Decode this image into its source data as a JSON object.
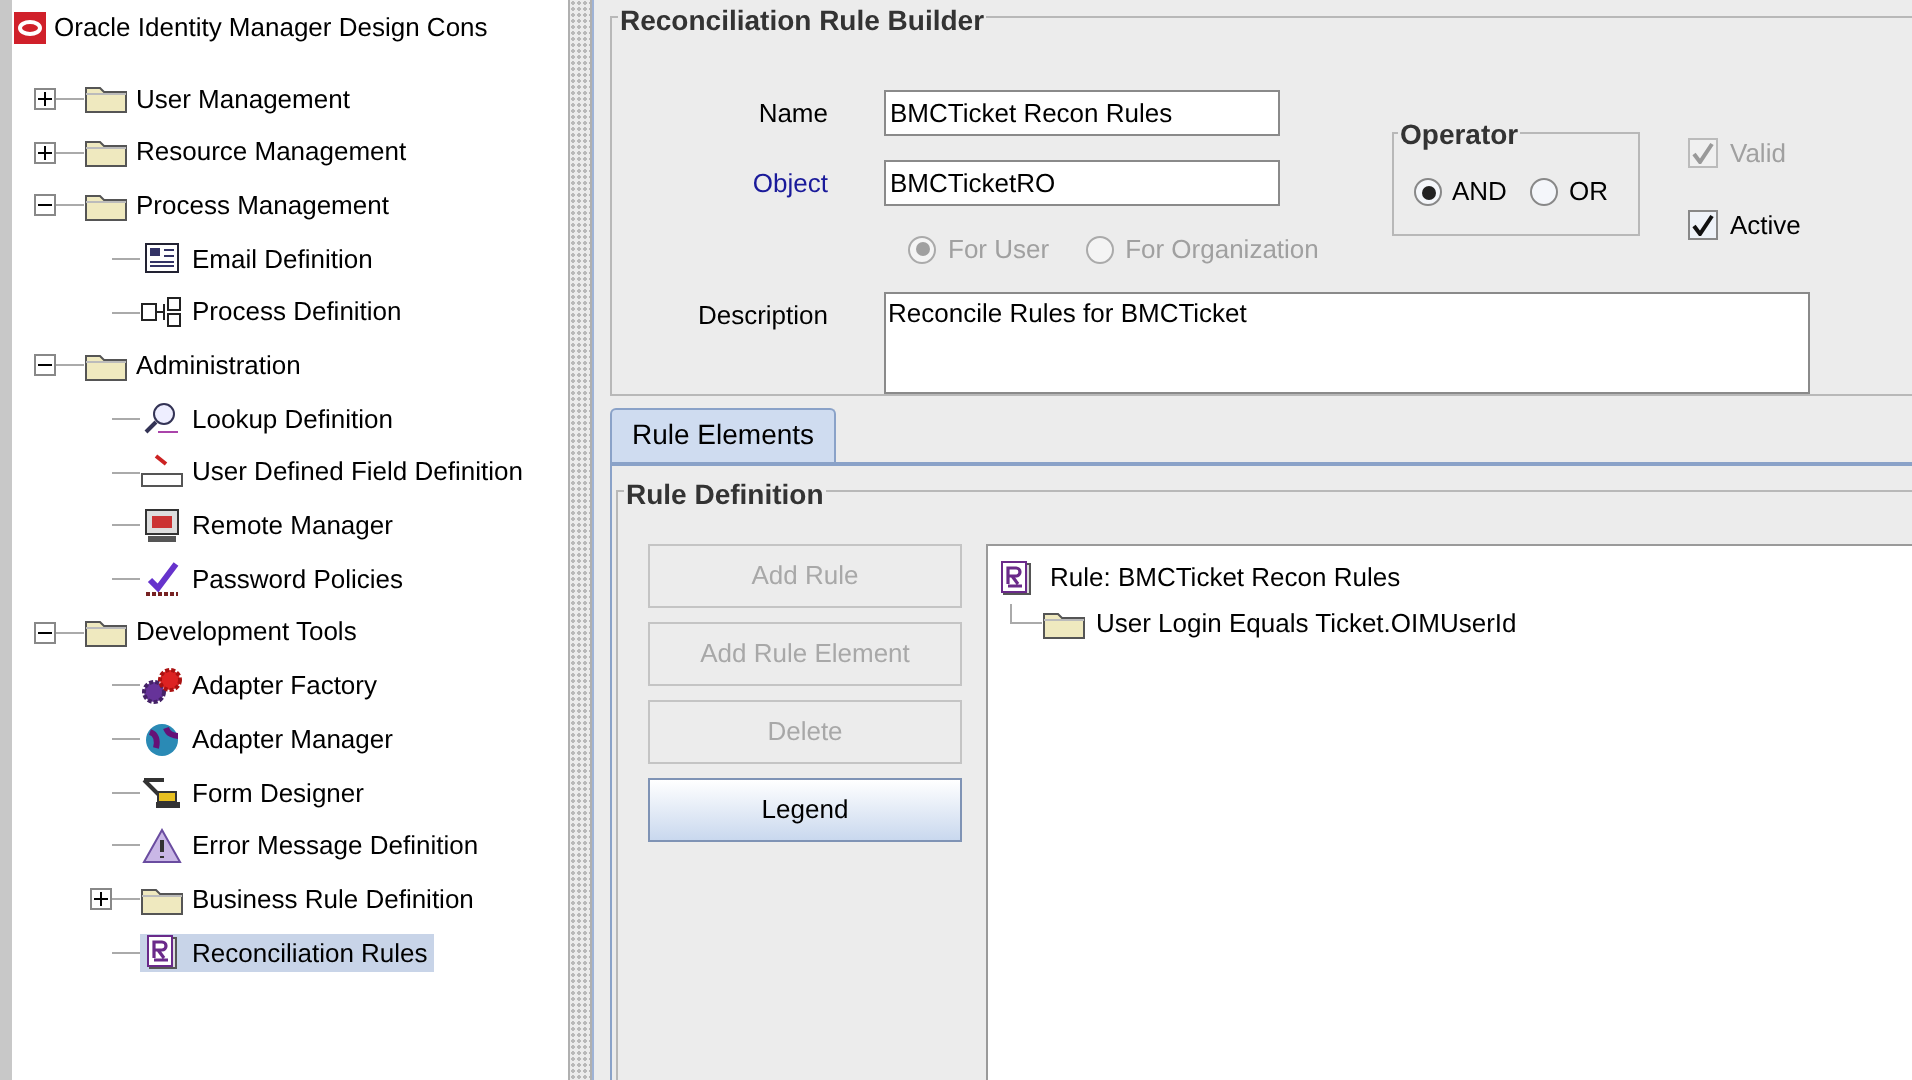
{
  "tree": {
    "title": "Oracle Identity Manager Design Cons",
    "items": [
      {
        "kind": "folder",
        "label": "User Management",
        "expanded": false,
        "selected": false
      },
      {
        "kind": "folder",
        "label": "Resource Management",
        "expanded": false,
        "selected": false
      },
      {
        "kind": "folder",
        "label": "Process Management",
        "expanded": true,
        "selected": false,
        "children": [
          {
            "kind": "email",
            "label": "Email Definition",
            "selected": false
          },
          {
            "kind": "process",
            "label": "Process Definition",
            "selected": false
          }
        ]
      },
      {
        "kind": "folder",
        "label": "Administration",
        "expanded": true,
        "selected": false,
        "children": [
          {
            "kind": "lookup",
            "label": "Lookup Definition",
            "selected": false
          },
          {
            "kind": "udf",
            "label": "User Defined Field Definition",
            "selected": false
          },
          {
            "kind": "remote",
            "label": "Remote Manager",
            "selected": false
          },
          {
            "kind": "password",
            "label": "Password Policies",
            "selected": false
          }
        ]
      },
      {
        "kind": "folder",
        "label": "Development Tools",
        "expanded": true,
        "selected": false,
        "children": [
          {
            "kind": "gears",
            "label": "Adapter Factory",
            "selected": false
          },
          {
            "kind": "globe",
            "label": "Adapter Manager",
            "selected": false
          },
          {
            "kind": "crane",
            "label": "Form Designer",
            "selected": false
          },
          {
            "kind": "warning",
            "label": "Error Message Definition",
            "selected": false
          },
          {
            "kind": "folder",
            "label": "Business Rule Definition",
            "expanded": false,
            "selected": false
          },
          {
            "kind": "rule",
            "label": "Reconciliation Rules",
            "selected": true
          }
        ]
      }
    ]
  },
  "builder": {
    "title": "Reconciliation Rule Builder",
    "fields": [
      {
        "kind": "plain",
        "label": "Name",
        "value": "BMCTicket Recon Rules"
      },
      {
        "kind": "lookup",
        "label": "Object",
        "value": "BMCTicketRO"
      }
    ],
    "target": {
      "disabled": true,
      "options": [
        {
          "label": "For User",
          "selected": true
        },
        {
          "label": "For Organization",
          "selected": false
        }
      ]
    },
    "operator": {
      "title": "Operator",
      "options": [
        {
          "label": "AND",
          "selected": true
        },
        {
          "label": "OR",
          "selected": false
        }
      ]
    },
    "checks": [
      {
        "label": "Valid",
        "checked": true,
        "disabled": true
      },
      {
        "label": "Active",
        "checked": true,
        "disabled": false
      }
    ],
    "description": {
      "label": "Description",
      "value": "Reconcile Rules for BMCTicket"
    }
  },
  "tabs": [
    {
      "label": "Rule Elements",
      "selected": true
    }
  ],
  "rule_definition": {
    "title": "Rule Definition",
    "buttons": [
      {
        "label": "Add Rule",
        "disabled": true
      },
      {
        "label": "Add Rule Element",
        "disabled": true
      },
      {
        "label": "Delete",
        "disabled": true
      },
      {
        "label": "Legend",
        "disabled": false
      }
    ],
    "rule": {
      "label": "Rule: BMCTicket Recon Rules",
      "children": [
        {
          "label": "User Login Equals Ticket.OIMUserId"
        }
      ]
    }
  }
}
